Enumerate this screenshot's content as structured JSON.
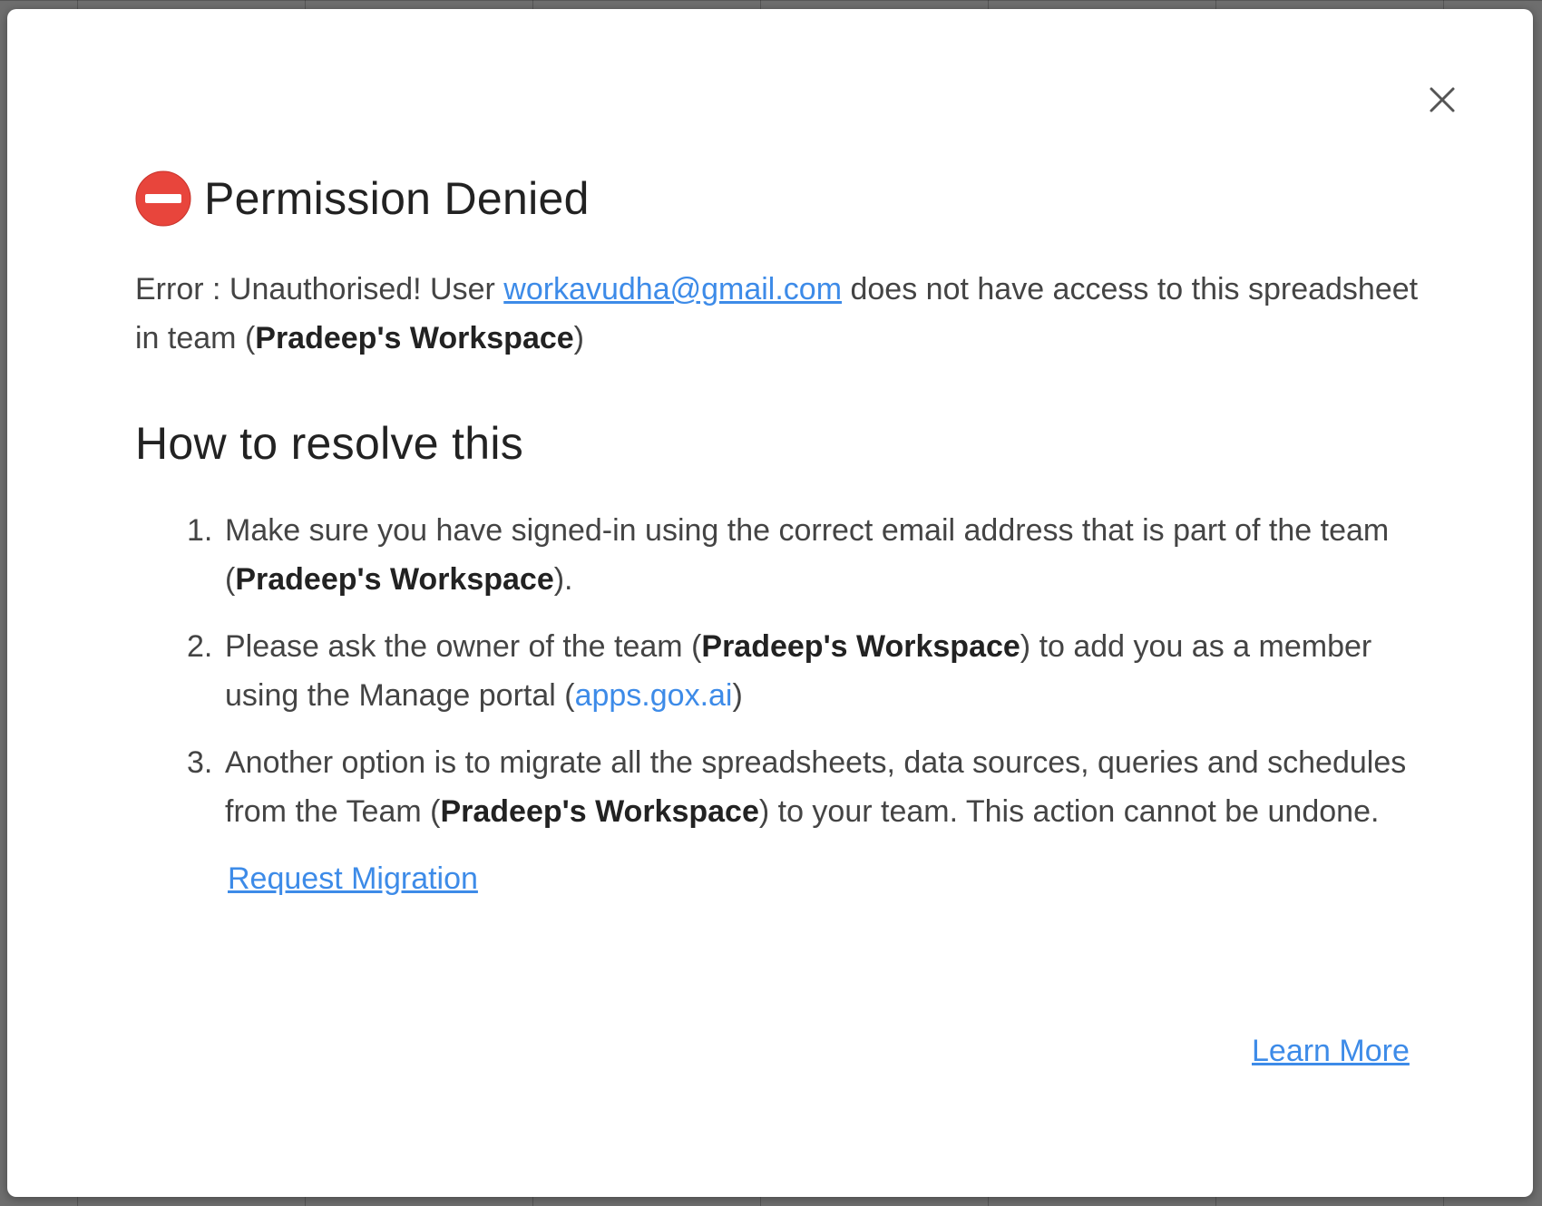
{
  "dialog": {
    "title": "Permission Denied",
    "icon": "no-entry-icon",
    "close_icon": "close-icon",
    "colors": {
      "link": "#3d8be8",
      "icon_red": "#e8453c"
    },
    "error": {
      "prefix": "Error : Unauthorised! User ",
      "email": "workavudha@gmail.com",
      "middle": " does not have access to this spreadsheet in team (",
      "team": "Pradeep's Workspace",
      "suffix": ")"
    },
    "subtitle": "How to resolve this",
    "steps": [
      {
        "num": "1.",
        "before": "Make sure you have signed-in using the correct email address that is part of the team (",
        "team": "Pradeep's Workspace",
        "after": ")."
      },
      {
        "num": "2.",
        "before": "Please ask the owner of the team (",
        "team": "Pradeep's Workspace",
        "middle": ") to add you as a member using the Manage portal (",
        "link": "apps.gox.ai",
        "after": ")"
      },
      {
        "num": "3.",
        "before": "Another option is to migrate all the spreadsheets, data sources, queries and schedules from the Team (",
        "team": "Pradeep's Workspace",
        "after": ") to your team. This action cannot be undone."
      }
    ],
    "request_migration_label": "Request Migration",
    "learn_more_label": "Learn More"
  }
}
